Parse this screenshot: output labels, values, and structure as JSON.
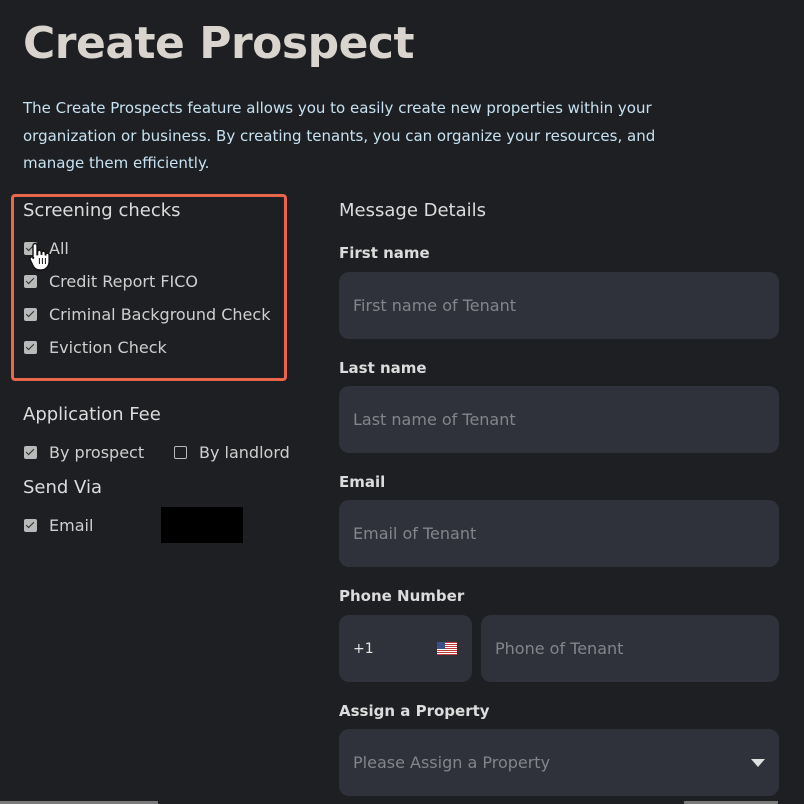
{
  "page": {
    "title": "Create Prospect",
    "intro": "The Create Prospects feature allows you to easily create new properties within your organization or business. By creating tenants, you can organize your resources, and manage them efficiently."
  },
  "screening": {
    "title": "Screening checks",
    "items": [
      {
        "label": "All",
        "checked": true
      },
      {
        "label": "Credit Report FICO",
        "checked": true
      },
      {
        "label": "Criminal Background Check",
        "checked": true
      },
      {
        "label": "Eviction Check",
        "checked": true
      }
    ]
  },
  "application_fee": {
    "title": "Application Fee",
    "by_prospect": {
      "label": "By prospect",
      "checked": true
    },
    "by_landlord": {
      "label": "By landlord",
      "checked": false
    }
  },
  "send_via": {
    "title": "Send Via",
    "email": {
      "label": "Email",
      "checked": true
    }
  },
  "message_details": {
    "title": "Message Details",
    "first_name": {
      "label": "First name",
      "placeholder": "First name of Tenant",
      "value": ""
    },
    "last_name": {
      "label": "Last name",
      "placeholder": "Last name of Tenant",
      "value": ""
    },
    "email": {
      "label": "Email",
      "placeholder": "Email of Tenant",
      "value": ""
    },
    "phone": {
      "label": "Phone Number",
      "country_code": "+1",
      "flag": "us-flag-icon",
      "placeholder": "Phone of Tenant",
      "value": ""
    },
    "property": {
      "label": "Assign a Property",
      "placeholder": "Please Assign a Property",
      "icon": "chevron-down-icon"
    }
  },
  "colors": {
    "background": "#1e1f22",
    "input_bg": "#2f323b",
    "highlight": "#e8664a",
    "intro_text": "#c6e2f2"
  }
}
